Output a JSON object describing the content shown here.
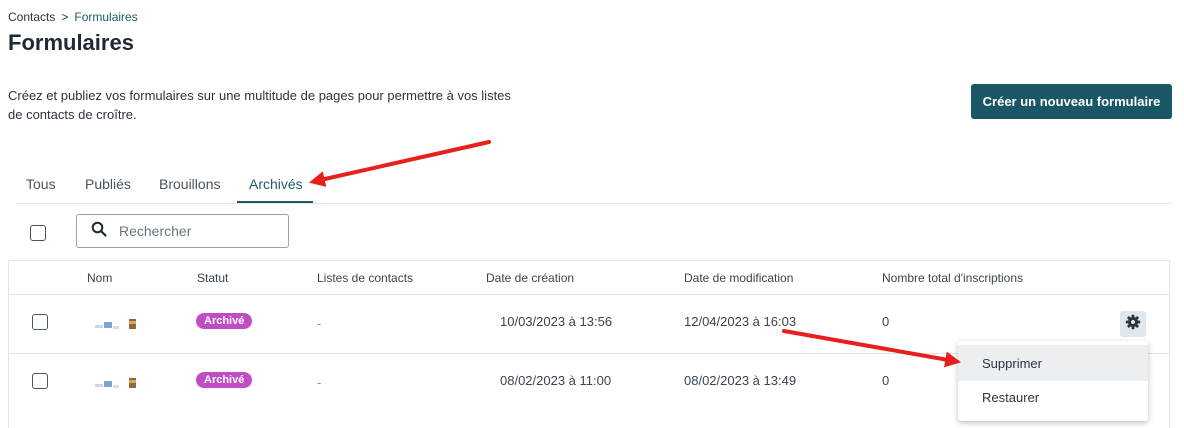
{
  "breadcrumb": {
    "parent": "Contacts",
    "separator": ">",
    "current": "Formulaires"
  },
  "page": {
    "title": "Formulaires",
    "description_line1": "Créez et publiez vos formulaires sur une multitude de pages pour permettre à vos listes",
    "description_line2": "de contacts de croître.",
    "create_button": "Créer un nouveau formulaire"
  },
  "tabs": [
    {
      "label": "Tous"
    },
    {
      "label": "Publiés"
    },
    {
      "label": "Brouillons"
    },
    {
      "label": "Archivés",
      "active": true
    }
  ],
  "search": {
    "placeholder": "Rechercher"
  },
  "table": {
    "headers": [
      "Nom",
      "Statut",
      "Listes de contacts",
      "Date de création",
      "Date de modification",
      "Nombre total d'inscriptions"
    ],
    "rows": [
      {
        "status": "Archivé",
        "lists": "-",
        "created": "10/03/2023 à 13:56",
        "modified": "12/04/2023 à 16:03",
        "subscriptions": "0"
      },
      {
        "status": "Archivé",
        "lists": "-",
        "created": "08/02/2023 à 11:00",
        "modified": "08/02/2023 à 13:49",
        "subscriptions": "0"
      }
    ]
  },
  "action_menu": {
    "delete": "Supprimer",
    "restore": "Restaurer"
  },
  "colors": {
    "accent": "#1a5766",
    "badge": "#c14dc4",
    "annotation_arrow": "#e8201c"
  },
  "icons": {
    "search": "search-icon",
    "gear": "gear-icon"
  }
}
